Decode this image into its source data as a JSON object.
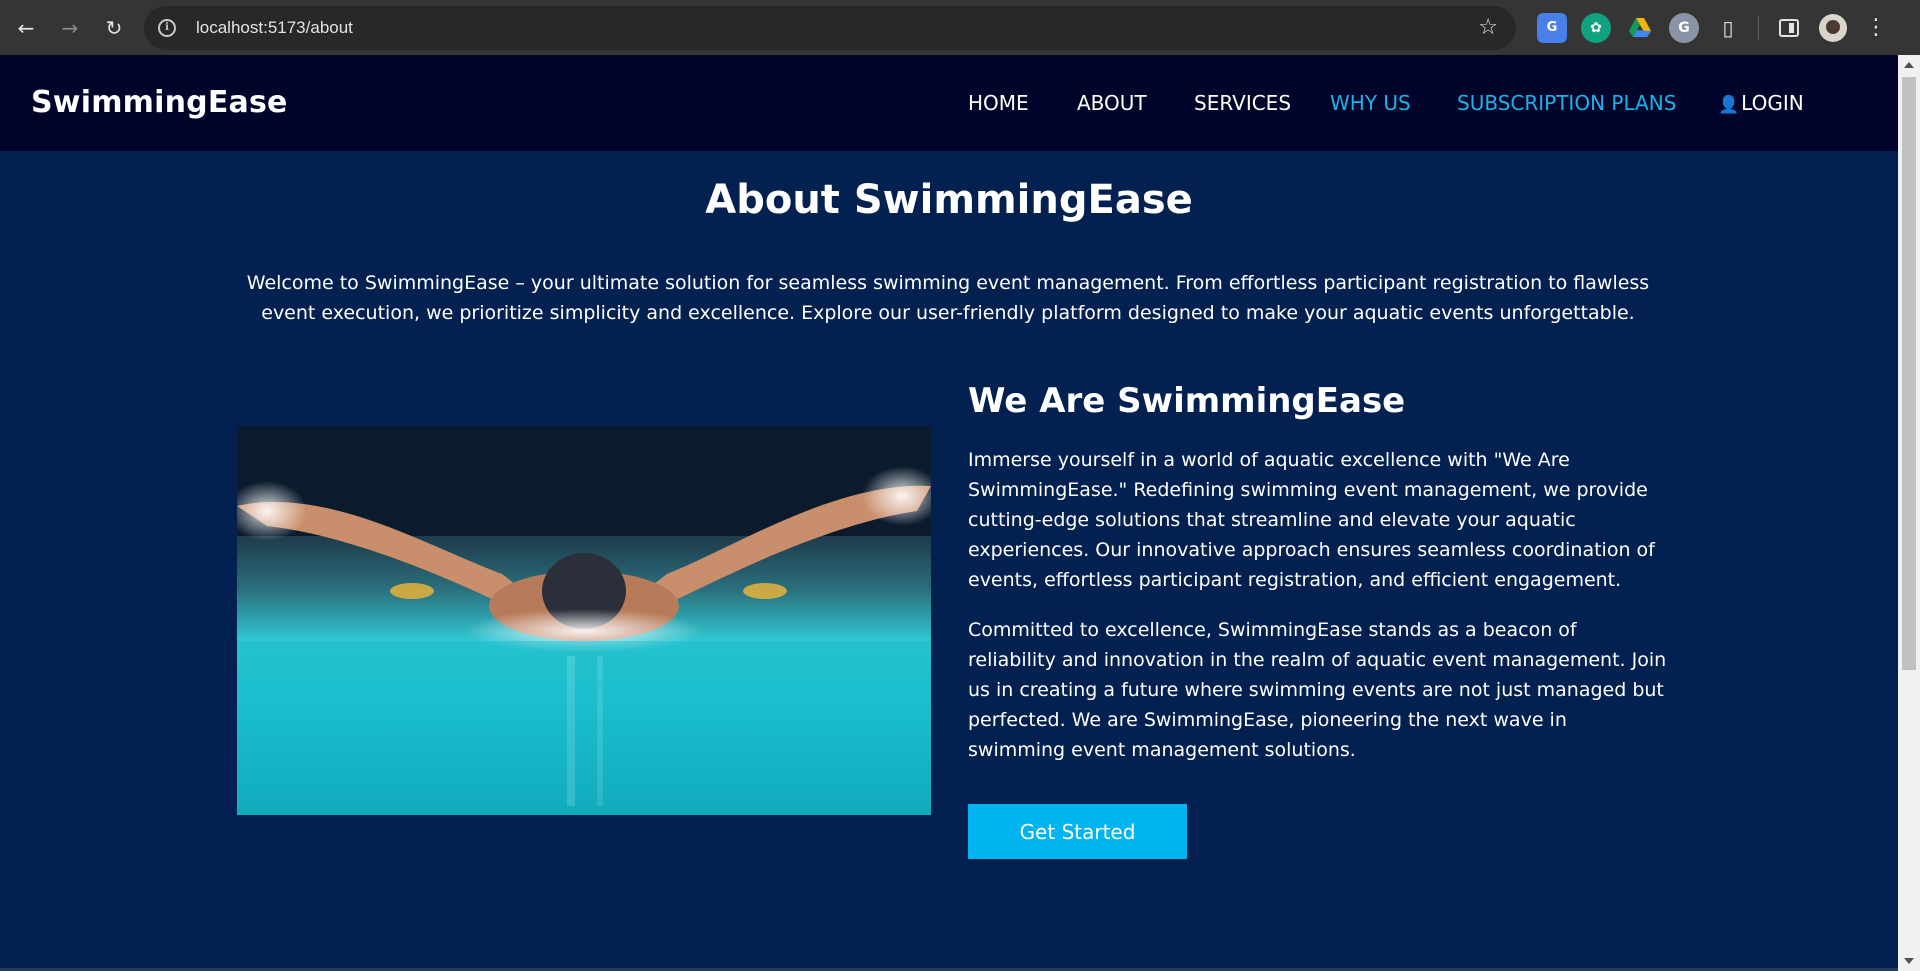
{
  "browser": {
    "url": "localhost:5173/about",
    "icons": {
      "back": "back-arrow-icon",
      "forward": "forward-arrow-icon",
      "reload": "reload-icon",
      "info": "site-info-icon",
      "bookmark": "star-icon",
      "translate": "google-translate-icon",
      "gpt": "chatgpt-icon",
      "drive": "google-drive-icon",
      "grammar": "grammarly-icon",
      "extensions": "puzzle-icon",
      "side_panel": "side-panel-icon",
      "profile": "avatar",
      "menu": "kebab-menu-icon"
    }
  },
  "site": {
    "brand": "SwimmingEase",
    "nav": {
      "home": "HOME",
      "about": "ABOUT",
      "services": "SERVICES",
      "why_us": "WHY US",
      "plans": "SUBSCRIPTION PLANS",
      "login": "LOGIN"
    },
    "colors": {
      "header_bg": "#01042a",
      "page_bg": "#022050",
      "accent": "#1ab3e8",
      "button_bg": "#00b4ef"
    }
  },
  "main": {
    "title": "About SwimmingEase",
    "intro": "Welcome to SwimmingEase – your ultimate solution for seamless swimming event management. From effortless participant registration to flawless event execution, we prioritize simplicity and excellence. Explore our user-friendly platform designed to make your aquatic events unforgettable.",
    "section_title": "We Are SwimmingEase",
    "paragraph_1": "Immerse yourself in a world of aquatic excellence with \"We Are SwimmingEase.\" Redefining swimming event management, we provide cutting-edge solutions that streamline and elevate your aquatic experiences. Our innovative approach ensures seamless coordination of events, effortless participant registration, and efficient engagement.",
    "paragraph_2": "Committed to excellence, SwimmingEase stands as a beacon of reliability and innovation in the realm of aquatic event management. Join us in creating a future where swimming events are not just managed but perfected. We are SwimmingEase, pioneering the next wave in swimming event management solutions.",
    "cta_label": "Get Started"
  }
}
